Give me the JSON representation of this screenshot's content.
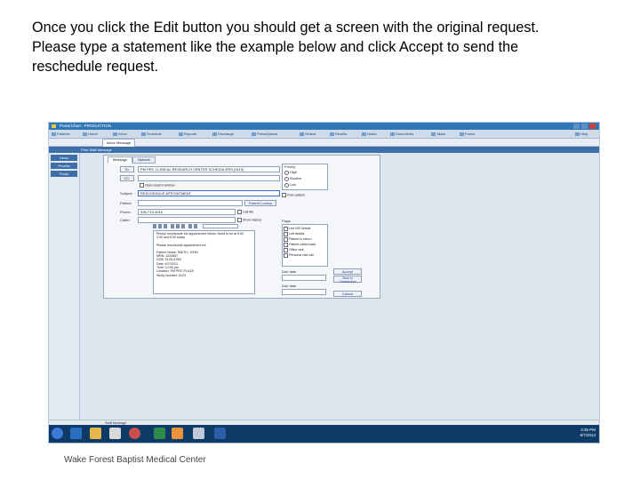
{
  "caption": {
    "line1": "Once you click the Edit button you should get a screen with the original request.",
    "line2": "Please type a statement like the example below and click Accept to send the",
    "line3": "reschedule request."
  },
  "footer": "Wake Forest Baptist Medical Center",
  "screenshot": {
    "title": "PowerChart - PRODUCTION",
    "toolbar_items": [
      "Patients",
      "Home",
      "Inbox",
      "Schedule",
      "Reports",
      "Discharge",
      "Prescriptions",
      "Orders",
      "Results",
      "Notes",
      "Documents",
      "Tasks",
      "Forms",
      "Help"
    ],
    "tab": "Inbox Message",
    "subbar": "Print   Staff Message",
    "left_nav": [
      "Inbox",
      "Proxies",
      "Pools"
    ],
    "dialog": {
      "tab_message": "Message",
      "tab_options": "Options",
      "to_label": "To:",
      "cc_label": "CC:",
      "to_value": "PM PRC CLINICAL RESEARCH CENTER SCHEDULERS (9115)",
      "open_search_label": "Open search window",
      "subject_label": "Subject:",
      "subject_value": "RESCHEDULE APPOINTMENT",
      "patient_label": "Patient:",
      "patient_lookup": "Patient Lookup",
      "phone_label": "Phone:",
      "phone_value": "336-713-4916",
      "caller_label": "Caller:",
      "call_me": "Call Me",
      "show_history": "Show History",
      "priority_label": "Priority",
      "priority_high": "High",
      "priority_routine": "Routine",
      "priority_low": "Low",
      "from_patient": "From patient",
      "flags_label": "Flags",
      "flag_items": [
        "Left VM Details",
        "Left details",
        "Patient to return",
        "Patient called back",
        "Office visit",
        "Personal visit call"
      ],
      "due_date_label": "Due date",
      "accept_label": "Accept",
      "save_to_chart": "Save to Chart/Action",
      "cancel_label": "Cancel",
      "body_lines": [
        "Please reschedule the appointment below. Need to be at 9:00",
        "3:30 and 5:00 today.",
        "",
        "Please reschedule appointment for:",
        "",
        "Patient Name: SMITH, JOHN",
        "MRN: 1234567",
        "DOB: 01/01/1959",
        "Date: 6/7/2013",
        "Time: 12:00 pm",
        "Location: PM PRC PLAZA",
        "Study Number: 6123"
      ]
    },
    "status_text": "Staff Message",
    "tray_time": "3:35 PM",
    "tray_date": "6/7/2013"
  },
  "colors": {
    "titlebar": "#2f78b5",
    "taskbar": "#0d3a66",
    "accent": "#2f6fcf"
  }
}
